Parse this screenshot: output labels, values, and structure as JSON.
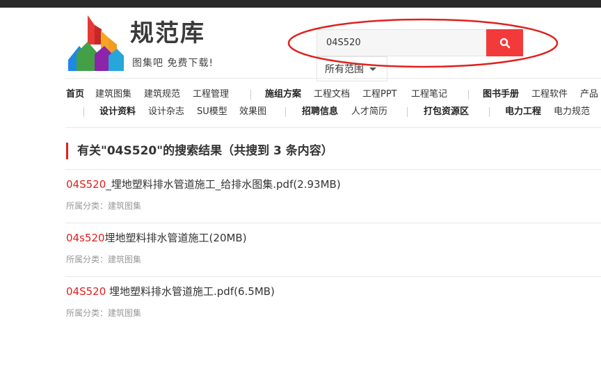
{
  "logo": {
    "title": "规范库",
    "slogan": "图集吧 免费下载!"
  },
  "search": {
    "value": "04S520",
    "button_icon": "search-icon",
    "scope_label": "所有范围"
  },
  "colors": {
    "accent": "#f23a3a",
    "keyword": "#e02020",
    "annotation": "#e0201e"
  },
  "nav": {
    "row1": [
      "首页",
      "建筑图集",
      "建筑规范",
      "工程管理",
      "施组方案",
      "工程文档",
      "工程PPT",
      "工程笔记",
      "图书手册",
      "工程软件",
      "产品"
    ],
    "row2": [
      "设计资料",
      "设计杂志",
      "SU模型",
      "效果图",
      "招聘信息",
      "人才简历",
      "打包资源区",
      "电力工程",
      "电力规范"
    ]
  },
  "results": {
    "heading": "有关\"04S520\"的搜索结果（共搜到 3 条内容）",
    "items": [
      {
        "keyword": "04S520",
        "rest": "_埋地塑料排水管道施工_给排水图集.pdf(2.93MB)",
        "category": "所属分类：建筑图集"
      },
      {
        "keyword": "04s520",
        "rest": "埋地塑料排水管道施工(20MB)",
        "category": "所属分类：建筑图集"
      },
      {
        "keyword": "04S520",
        "rest": " 埋地塑料排水管道施工.pdf(6.5MB)",
        "category": "所属分类：建筑图集"
      }
    ]
  }
}
